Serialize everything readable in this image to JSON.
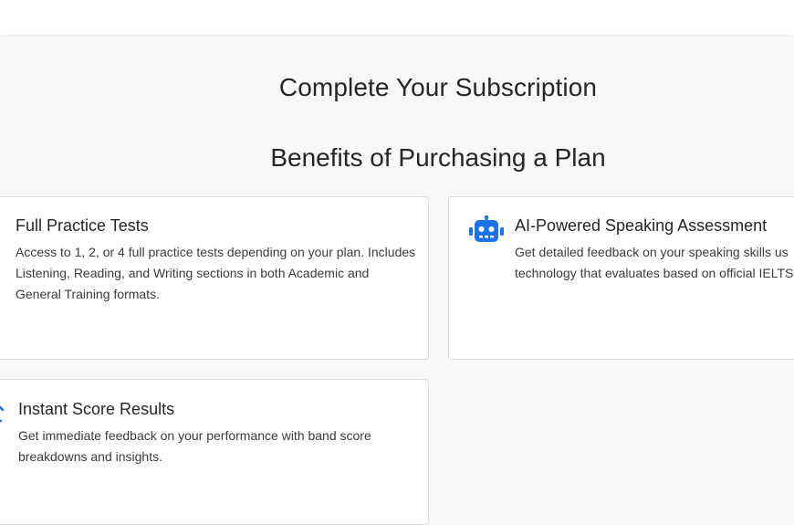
{
  "page": {
    "title": "Complete Your Subscription",
    "section_title": "Benefits of Purchasing a Plan"
  },
  "benefits": [
    {
      "icon": "document-icon",
      "title": "Full Practice Tests",
      "description": "Access to 1, 2, or 4 full practice tests depending on your plan. Includes Listening, Reading, and Writing sections in both Academic and General Training formats."
    },
    {
      "icon": "robot-icon",
      "title": "AI-Powered Speaking Assessment",
      "description_line1": "Get detailed feedback on your speaking skills us",
      "description_line2": "technology that evaluates based on official IELTS"
    },
    {
      "icon": "chart-icon",
      "title": "Instant Score Results",
      "description": "Get immediate feedback on your performance with band score breakdowns and insights."
    }
  ],
  "colors": {
    "accent": "#1a73e8",
    "background": "#f8f8f8",
    "card": "#ffffff"
  }
}
